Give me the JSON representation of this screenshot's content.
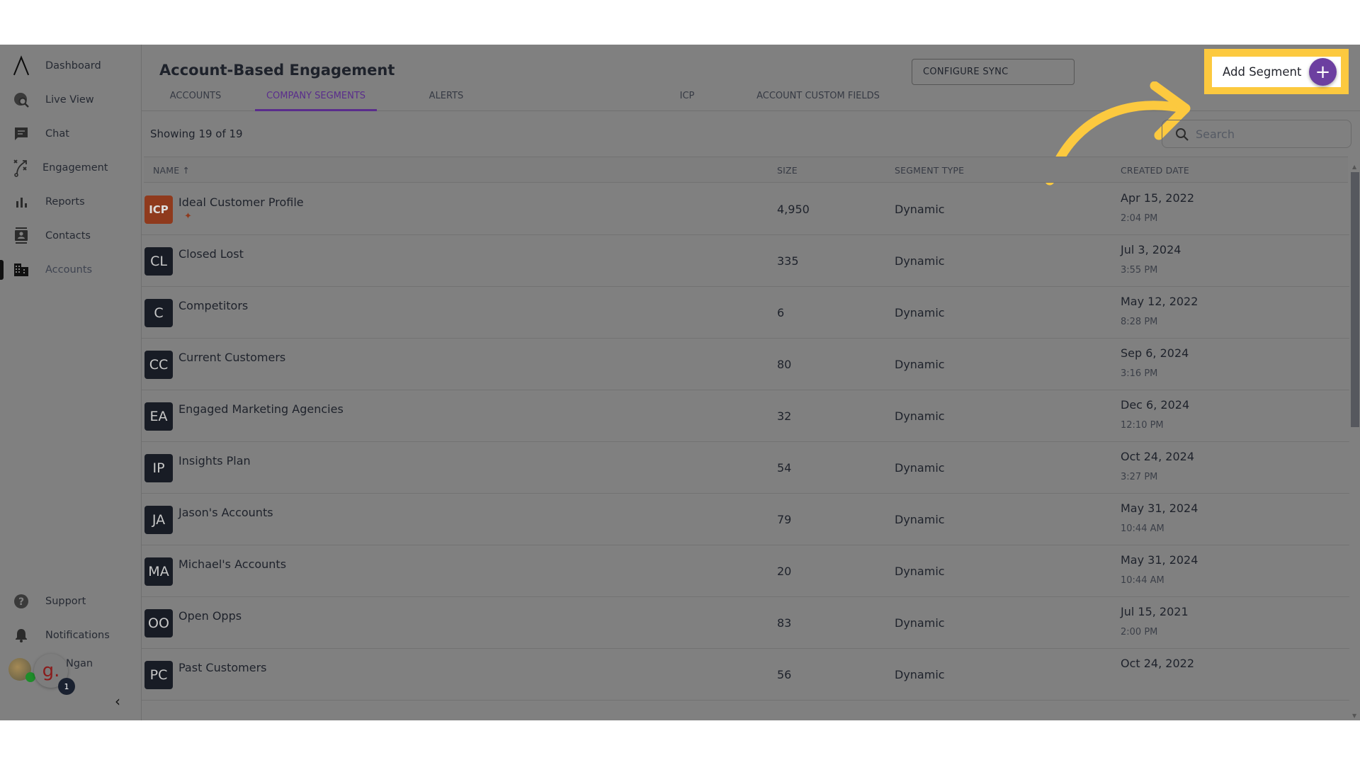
{
  "sidebar": {
    "items": [
      {
        "label": "Dashboard",
        "icon": "logo-icon"
      },
      {
        "label": "Live View",
        "icon": "globe-search-icon"
      },
      {
        "label": "Chat",
        "icon": "chat-icon"
      },
      {
        "label": "Engagement",
        "icon": "strategy-icon"
      },
      {
        "label": "Reports",
        "icon": "bar-chart-icon"
      },
      {
        "label": "Contacts",
        "icon": "contacts-icon"
      },
      {
        "label": "Accounts",
        "icon": "building-icon",
        "active": true
      }
    ],
    "bottom": [
      {
        "label": "Support",
        "icon": "help-icon"
      },
      {
        "label": "Notifications",
        "icon": "bell-icon"
      }
    ],
    "user": {
      "name": "Ngan",
      "logo_letter": "g.",
      "badge_count": "1"
    },
    "collapse_glyph": "‹"
  },
  "header": {
    "title": "Account-Based Engagement",
    "tabs": [
      {
        "label": "ACCOUNTS"
      },
      {
        "label": "COMPANY SEGMENTS",
        "active": true
      },
      {
        "label": "ALERTS"
      },
      {
        "label": "ICP"
      },
      {
        "label": "ACCOUNT CUSTOM FIELDS"
      }
    ],
    "config_button": "CONFIGURE SYNC",
    "add_button": "Add Segment",
    "add_glyph": "+"
  },
  "toolbar": {
    "showing": "Showing 19 of  19",
    "search_placeholder": "Search"
  },
  "table": {
    "headers": {
      "name": "NAME ↑",
      "size": "SIZE",
      "type": "SEGMENT TYPE",
      "created": "CREATED DATE"
    },
    "rows": [
      {
        "initials": "ICP",
        "name": "Ideal Customer Profile",
        "size": "4,950",
        "type": "Dynamic",
        "date": "Apr 15, 2022",
        "time": "2:04 PM",
        "icp": true
      },
      {
        "initials": "CL",
        "name": "Closed Lost",
        "size": "335",
        "type": "Dynamic",
        "date": "Jul 3, 2024",
        "time": "3:55 PM"
      },
      {
        "initials": "C",
        "name": "Competitors",
        "size": "6",
        "type": "Dynamic",
        "date": "May 12, 2022",
        "time": "8:28 PM"
      },
      {
        "initials": "CC",
        "name": "Current Customers",
        "size": "80",
        "type": "Dynamic",
        "date": "Sep 6, 2024",
        "time": "3:16 PM"
      },
      {
        "initials": "EA",
        "name": "Engaged Marketing Agencies",
        "size": "32",
        "type": "Dynamic",
        "date": "Dec 6, 2024",
        "time": "12:10 PM"
      },
      {
        "initials": "IP",
        "name": "Insights Plan",
        "size": "54",
        "type": "Dynamic",
        "date": "Oct 24, 2024",
        "time": "3:27 PM"
      },
      {
        "initials": "JA",
        "name": "Jason's Accounts",
        "size": "79",
        "type": "Dynamic",
        "date": "May 31, 2024",
        "time": "10:44 AM"
      },
      {
        "initials": "MA",
        "name": "Michael's Accounts",
        "size": "20",
        "type": "Dynamic",
        "date": "May 31, 2024",
        "time": "10:44 AM"
      },
      {
        "initials": "OO",
        "name": "Open Opps",
        "size": "83",
        "type": "Dynamic",
        "date": "Jul 15, 2021",
        "time": "2:00 PM"
      },
      {
        "initials": "PC",
        "name": "Past Customers",
        "size": "56",
        "type": "Dynamic",
        "date": "Oct 24, 2022",
        "time": ""
      }
    ]
  },
  "colors": {
    "accent": "#5a2d8c",
    "add_button_circle": "#6c3fa0",
    "highlight": "#fcc93f",
    "icp_avatar": "#8f3a1d",
    "avatar": "#181c25"
  }
}
